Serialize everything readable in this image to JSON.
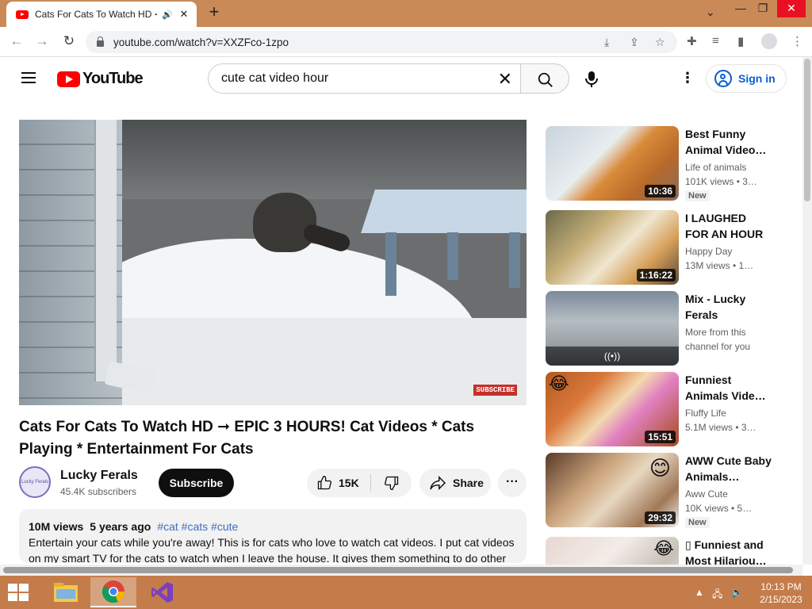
{
  "browser": {
    "tab_title": "Cats For Cats To Watch HD ➞",
    "audio_icon": "speaker-icon",
    "close_glyph": "✕",
    "new_tab_glyph": "+",
    "url": "youtube.com/watch?v=XXZFco-1zpo"
  },
  "header": {
    "logo_text": "YouTube",
    "search_value": "cute cat video hour",
    "search_placeholder": "Search",
    "signin_label": "Sign in"
  },
  "video": {
    "title": "Cats For Cats To Watch HD ➞ EPIC 3 HOURS! Cat Videos * Cats Playing * Entertainment For Cats",
    "watermark": "SUBSCRIBE",
    "channel": "Lucky Ferals",
    "channel_avatar_text": "Lucky Ferals",
    "subscribers": "45.4K subscribers",
    "subscribe_label": "Subscribe",
    "likes": "15K",
    "share_label": "Share",
    "more_glyph": "···"
  },
  "description": {
    "views": "10M views",
    "age": "5 years ago",
    "tags": "#cat #cats #cute",
    "text": "Entertain your cats while you're away! This is for cats who love to watch cat videos. I put cat videos on my smart TV for the cats to watch when I leave the house. It gives them something to do other"
  },
  "recommendations": [
    {
      "title": "Best Funny Animal Video…",
      "channel": "Life of animals",
      "views": "101K views  • 3…",
      "duration": "10:36",
      "badge": "New",
      "mix_label": ""
    },
    {
      "title": "I LAUGHED FOR AN HOUR😹…",
      "channel": "Happy Day",
      "views": "13M views  • 1…",
      "duration": "1:16:22",
      "badge": "",
      "mix_label": ""
    },
    {
      "title": "Mix - Lucky Ferals",
      "channel": "More from this",
      "views": "channel for you",
      "duration": "",
      "badge": "",
      "mix_label": "((•))"
    },
    {
      "title": "Funniest Animals Vide…",
      "channel": "Fluffy Life",
      "views": "5.1M views  • 3…",
      "duration": "15:51",
      "badge": "",
      "mix_label": ""
    },
    {
      "title": "AWW Cute Baby Animals…",
      "channel": "Aww Cute",
      "views": "10K views  • 5…",
      "duration": "29:32",
      "badge": "New",
      "mix_label": ""
    },
    {
      "title": "▯ Funniest and Most Hilariou…",
      "channel": "",
      "views": "",
      "duration": "",
      "badge": "",
      "mix_label": ""
    }
  ],
  "taskbar": {
    "time": "10:13 PM",
    "date": "2/15/2023"
  },
  "colors": {
    "accent_red": "#ff0000",
    "link_blue": "#065fd4",
    "taskbar": "#c47c4a",
    "tabstrip": "#c98a58"
  }
}
